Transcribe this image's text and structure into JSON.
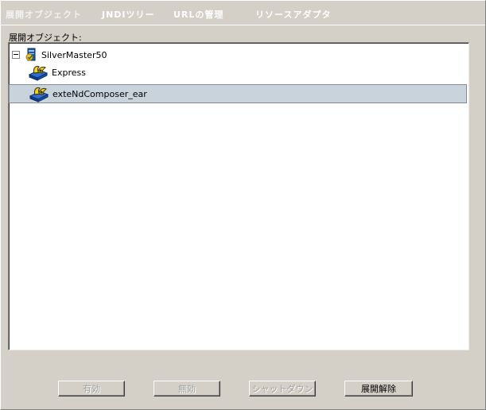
{
  "tabs": [
    {
      "label": "展開オブジェクト",
      "active": true
    },
    {
      "label": "JNDIツリー",
      "active": false
    },
    {
      "label": "URLの管理",
      "active": false
    },
    {
      "label": "リソースアダプタ",
      "active": false
    }
  ],
  "section_label": "展開オブジェクト:",
  "tree": {
    "root": {
      "label": "SilverMaster50",
      "icon": "server-icon",
      "expanded": true
    },
    "children": [
      {
        "label": "Express",
        "icon": "deployed-object-icon",
        "selected": false
      },
      {
        "label": "exteNdComposer_ear",
        "icon": "deployed-object-icon",
        "selected": true
      }
    ]
  },
  "buttons": {
    "enable": {
      "label": "有効",
      "enabled": false
    },
    "disable": {
      "label": "無効",
      "enabled": false
    },
    "shutdown": {
      "label": "シャットダウン",
      "enabled": false
    },
    "undeploy": {
      "label": "展開解除",
      "enabled": true
    }
  },
  "colors": {
    "background": "#d4d0c8",
    "selection": "#c8d3dc",
    "tab_text": "#ffffff"
  }
}
